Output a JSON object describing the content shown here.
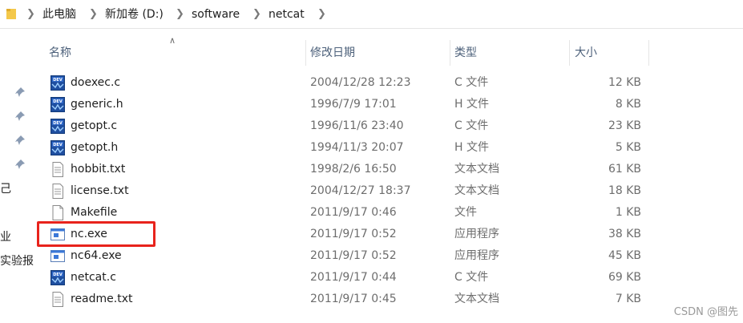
{
  "address_bar": {
    "segments": [
      "此电脑",
      "新加卷 (D:)",
      "software",
      "netcat"
    ]
  },
  "nav": {
    "pins": 4,
    "labels": [
      "己",
      "业",
      "实验报"
    ]
  },
  "columns": {
    "name": "名称",
    "date": "修改日期",
    "type": "类型",
    "size": "大小"
  },
  "files": [
    {
      "name": "doexec.c",
      "date": "2004/12/28 12:23",
      "type": "C 文件",
      "size": "12 KB",
      "icon": "dev-cpp-source-icon"
    },
    {
      "name": "generic.h",
      "date": "1996/7/9 17:01",
      "type": "H 文件",
      "size": "8 KB",
      "icon": "dev-cpp-source-icon"
    },
    {
      "name": "getopt.c",
      "date": "1996/11/6 23:40",
      "type": "C 文件",
      "size": "23 KB",
      "icon": "dev-cpp-source-icon"
    },
    {
      "name": "getopt.h",
      "date": "1994/11/3 20:07",
      "type": "H 文件",
      "size": "5 KB",
      "icon": "dev-cpp-source-icon"
    },
    {
      "name": "hobbit.txt",
      "date": "1998/2/6 16:50",
      "type": "文本文档",
      "size": "61 KB",
      "icon": "text-document-icon"
    },
    {
      "name": "license.txt",
      "date": "2004/12/27 18:37",
      "type": "文本文档",
      "size": "18 KB",
      "icon": "text-document-icon"
    },
    {
      "name": "Makefile",
      "date": "2011/9/17 0:46",
      "type": "文件",
      "size": "1 KB",
      "icon": "blank-file-icon"
    },
    {
      "name": "nc.exe",
      "date": "2011/9/17 0:52",
      "type": "应用程序",
      "size": "38 KB",
      "icon": "application-icon"
    },
    {
      "name": "nc64.exe",
      "date": "2011/9/17 0:52",
      "type": "应用程序",
      "size": "45 KB",
      "icon": "application-icon"
    },
    {
      "name": "netcat.c",
      "date": "2011/9/17 0:44",
      "type": "C 文件",
      "size": "69 KB",
      "icon": "dev-cpp-source-icon"
    },
    {
      "name": "readme.txt",
      "date": "2011/9/17 0:45",
      "type": "文本文档",
      "size": "7 KB",
      "icon": "text-document-icon"
    }
  ],
  "highlighted_file": "nc.exe",
  "highlight_color": "#e8231c",
  "watermark": "CSDN @图先"
}
